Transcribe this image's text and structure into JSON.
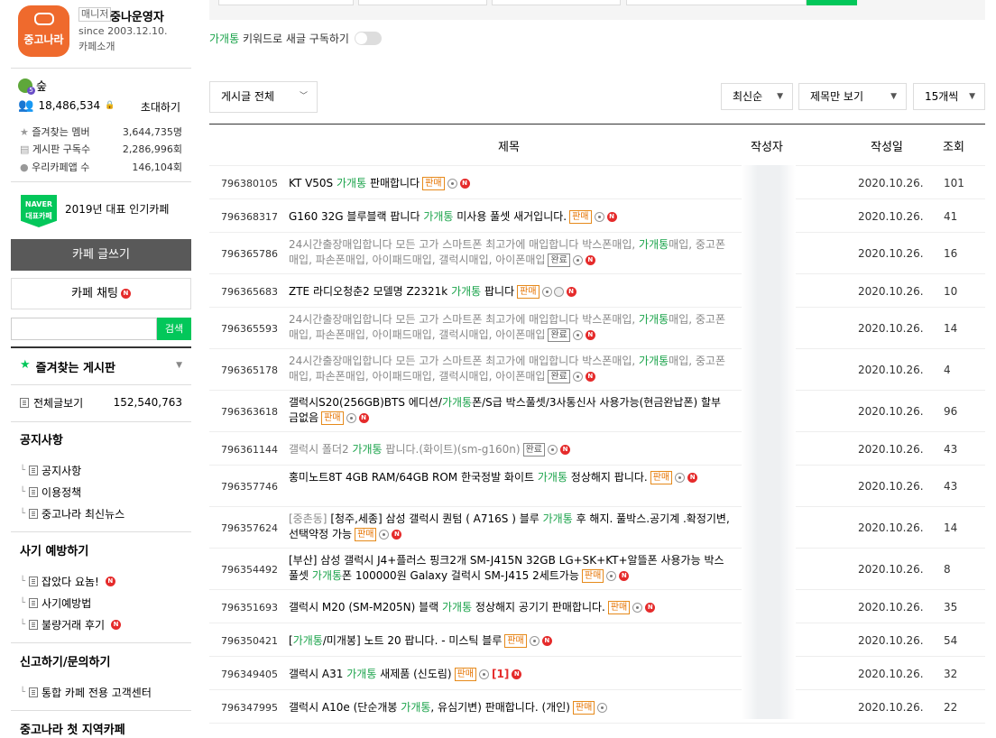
{
  "cafe": {
    "manager_badge": "매니저",
    "name": "중나운영자",
    "since": "since 2003.12.10.",
    "intro": "카페소개",
    "logo_text": "중고나라",
    "level": "숲",
    "members": "18,486,534",
    "invite": "초대하기",
    "stats": [
      {
        "label": "즐겨찾는 멤버",
        "value": "3,644,735명"
      },
      {
        "label": "게시판 구독수",
        "value": "2,286,996회"
      },
      {
        "label": "우리카페앱 수",
        "value": "146,104회"
      }
    ],
    "naver_badge_top": "NAVER",
    "naver_badge_bottom": "대표카페",
    "popular": "2019년 대표 인기카페",
    "write_button": "카페 글쓰기",
    "chat_button": "카페 채팅",
    "search_button": "검색",
    "fav_boards": "즐겨찾는 게시판",
    "all_posts": "전체글보기",
    "all_count": "152,540,763",
    "sections": [
      {
        "title": "공지사항",
        "items": [
          "공지사항",
          "이용정책",
          "중고나라 최신뉴스"
        ]
      },
      {
        "title": "사기 예방하기",
        "items": [
          "잡았다 요놈!",
          "사기예방법",
          "불량거래 후기"
        ]
      },
      {
        "title": "신고하기/문의하기",
        "items": [
          "통합 카페 전용 고객센터"
        ]
      },
      {
        "title": "중고나라 첫 지역카페",
        "items": []
      }
    ]
  },
  "main": {
    "kw_green": "가개통",
    "kw_text": " 키워드로 새글 구독하기",
    "filter_all": "게시글 전체",
    "sort": "최신순",
    "view": "제목만 보기",
    "per_page": "15개씩",
    "headers": {
      "title": "제목",
      "author": "작성자",
      "date": "작성일",
      "views": "조회"
    }
  },
  "rows": [
    {
      "id": "796380105",
      "parts": [
        [
          "KT V50S ",
          ""
        ],
        [
          "가개통",
          "g"
        ],
        [
          " 판매합니다",
          ""
        ]
      ],
      "tag": "판매",
      "icons": "cn",
      "date": "2020.10.26.",
      "views": "101"
    },
    {
      "id": "796368317",
      "parts": [
        [
          "G160 32G 블루블랙 팝니다 ",
          ""
        ],
        [
          "가개통",
          "g"
        ],
        [
          " 미사용 풀셋 새거입니다.",
          ""
        ]
      ],
      "tag": "판매",
      "icons": "cn",
      "date": "2020.10.26.",
      "views": "41"
    },
    {
      "id": "796365786",
      "parts": [
        [
          "24시간출장매입합니다 모든 고가 스마트폰 최고가에 매입합니다 박스폰매입, ",
          "gray"
        ],
        [
          "가개통",
          "g"
        ],
        [
          "매입, 중고폰매입, 파손폰매입, 아이패드매입, 갤럭시매입, 아이폰매입",
          "gray"
        ]
      ],
      "tag": "완료",
      "icons": "cn",
      "date": "2020.10.26.",
      "views": "16"
    },
    {
      "id": "796365683",
      "parts": [
        [
          "ZTE 라디오청춘2 모델명 Z2321k ",
          ""
        ],
        [
          "가개통",
          "g"
        ],
        [
          " 팝니다",
          ""
        ]
      ],
      "tag": "판매",
      "icons": "cln",
      "date": "2020.10.26.",
      "views": "10"
    },
    {
      "id": "796365593",
      "parts": [
        [
          "24시간출장매입합니다 모든 고가 스마트폰 최고가에 매입합니다 박스폰매입, ",
          "gray"
        ],
        [
          "가개통",
          "g"
        ],
        [
          "매입, 중고폰매입, 파손폰매입, 아이패드매입, 갤럭시매입, 아이폰매입",
          "gray"
        ]
      ],
      "tag": "완료",
      "icons": "cn",
      "date": "2020.10.26.",
      "views": "14"
    },
    {
      "id": "796365178",
      "parts": [
        [
          "24시간출장매입합니다 모든 고가 스마트폰 최고가에 매입합니다 박스폰매입, ",
          "gray"
        ],
        [
          "가개통",
          "g"
        ],
        [
          "매입, 중고폰매입, 파손폰매입, 아이패드매입, 갤럭시매입, 아이폰매입",
          "gray"
        ]
      ],
      "tag": "완료",
      "icons": "cn",
      "date": "2020.10.26.",
      "views": "4"
    },
    {
      "id": "796363618",
      "parts": [
        [
          "갤럭시S20(256GB)BTS 에디션/",
          ""
        ],
        [
          "가개통",
          "g"
        ],
        [
          "폰/S급 박스풀셋/3사통신사 사용가능(현금완납폰) 할부금없음",
          ""
        ]
      ],
      "tag": "판매",
      "icons": "cn",
      "date": "2020.10.26.",
      "views": "96"
    },
    {
      "id": "796361144",
      "parts": [
        [
          "갤럭시 폴더2 ",
          "gray"
        ],
        [
          "가개통",
          "g"
        ],
        [
          " 팝니다.(화이트)(sm-g160n)",
          "gray"
        ]
      ],
      "tag": "완료",
      "icons": "cn",
      "date": "2020.10.26.",
      "views": "43"
    },
    {
      "id": "796357746",
      "parts": [
        [
          "홍미노트8T 4GB RAM/64GB ROM 한국정발 화이트 ",
          ""
        ],
        [
          "가개통",
          "g"
        ],
        [
          " 정상해지 팝니다.",
          ""
        ]
      ],
      "tag": "판매",
      "icons": "cn",
      "date": "2020.10.26.",
      "views": "43"
    },
    {
      "id": "796357624",
      "parts": [
        [
          "[중촌동] ",
          "gray"
        ],
        [
          "[청주,세종] 삼성 갤럭시 퀀텀 ( A716S ) 블루 ",
          ""
        ],
        [
          "가개통",
          "g"
        ],
        [
          " 후 해지. 풀박스.공기계 .확정기변,선택약정 가능",
          ""
        ]
      ],
      "tag": "판매",
      "icons": "cn",
      "date": "2020.10.26.",
      "views": "14"
    },
    {
      "id": "796354492",
      "parts": [
        [
          "[부산] 삼성 갤럭시 J4+플러스 핑크2개 SM-J415N 32GB LG+SK+KT+알뜰폰 사용가능 박스풀셋 ",
          ""
        ],
        [
          "가개통",
          "g"
        ],
        [
          "폰 100000원 Galaxy 걸럭시 SM-J415 2세트가능",
          ""
        ]
      ],
      "tag": "판매",
      "icons": "cn",
      "date": "2020.10.26.",
      "views": "8"
    },
    {
      "id": "796351693",
      "parts": [
        [
          "갤럭시 M20 (SM-M205N) 블랙 ",
          ""
        ],
        [
          "가개통",
          "g"
        ],
        [
          " 정상해지 공기기 판매합니다.",
          ""
        ]
      ],
      "tag": "판매",
      "icons": "cn",
      "date": "2020.10.26.",
      "views": "35"
    },
    {
      "id": "796350421",
      "parts": [
        [
          "[",
          ""
        ],
        [
          "가개통",
          "g"
        ],
        [
          "/미개봉] 노트 20 팝니다. - 미스틱 블루",
          ""
        ]
      ],
      "tag": "판매",
      "icons": "cn",
      "date": "2020.10.26.",
      "views": "54"
    },
    {
      "id": "796349405",
      "parts": [
        [
          "갤럭시 A31 ",
          ""
        ],
        [
          "가개통",
          "g"
        ],
        [
          " 새제품 (신도림)",
          ""
        ]
      ],
      "tag": "판매",
      "icons": "c",
      "comment": "[1]",
      "date": "2020.10.26.",
      "views": "32"
    },
    {
      "id": "796347995",
      "parts": [
        [
          "갤럭시 A10e (단순개봉 ",
          ""
        ],
        [
          "가개통",
          "g"
        ],
        [
          ", 유심기변) 판매합니다. (개인)",
          ""
        ]
      ],
      "tag": "판매",
      "icons": "c",
      "date": "2020.10.26.",
      "views": "22"
    }
  ]
}
